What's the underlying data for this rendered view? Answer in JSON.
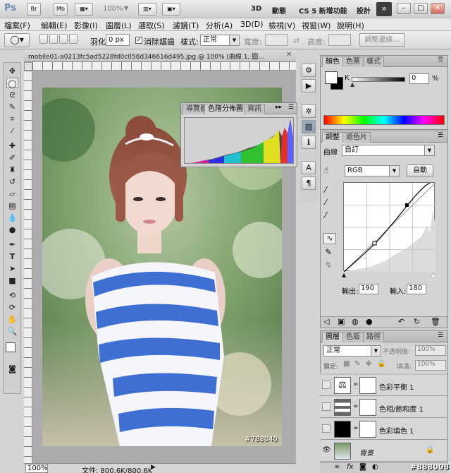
{
  "titlebar": {
    "app_logo": "Ps",
    "btn_br": "Br",
    "btn_mb": "Mb",
    "zoom": "100%",
    "mode_3d": "3D",
    "motion": "動態",
    "new_features": "CS 5 新增功能",
    "design": "設計"
  },
  "menu": [
    "檔案(F)",
    "編輯(E)",
    "影像(I)",
    "圖層(L)",
    "選取(S)",
    "濾鏡(T)",
    "分析(A)",
    "3D(D)",
    "檢視(V)",
    "視窗(W)",
    "說明(H)"
  ],
  "options": {
    "feather_label": "羽化:",
    "feather_value": "0 px",
    "antialias_label": "消除鋸齒",
    "style_label": "樣式:",
    "style_value": "正常",
    "width_label": "寬度:",
    "height_label": "高度:",
    "refine_edge": "調整邊緣..."
  },
  "document": {
    "tab_title": "mobile01-a0213fc5ad5228fd0c058d346616d495.jpg @ 100% (曲線 1, 圖...",
    "zoom": "100%",
    "file_info": "文件: 800.6K/800.6K",
    "watermark": "#783040"
  },
  "histogram": {
    "tabs": [
      "導覽器",
      "色階分佈圖",
      "資訊"
    ]
  },
  "color_panel": {
    "tabs": [
      "顏色",
      "色票",
      "樣式"
    ],
    "channel": "K",
    "value": "0",
    "unit": "%"
  },
  "adjust_panel": {
    "tabs": [
      "調整",
      "遮色片"
    ],
    "type_label": "曲線",
    "preset": "自訂",
    "channel": "RGB",
    "auto": "自動",
    "output_label": "輸出:",
    "output_value": "190",
    "input_label": "輸入:",
    "input_value": "180"
  },
  "layers_panel": {
    "tabs": [
      "圖層",
      "色版",
      "路徑"
    ],
    "blend_mode": "正常",
    "opacity_label": "不透明度:",
    "opacity_value": "100%",
    "lock_label": "鎖定:",
    "fill_label": "填滿:",
    "fill_value": "100%",
    "layers": [
      {
        "name": "色彩平衡 1"
      },
      {
        "name": "色相/飽和度 1"
      },
      {
        "name": "色彩填色 1"
      },
      {
        "name": "背景"
      }
    ]
  },
  "corner_watermark": "#888008"
}
